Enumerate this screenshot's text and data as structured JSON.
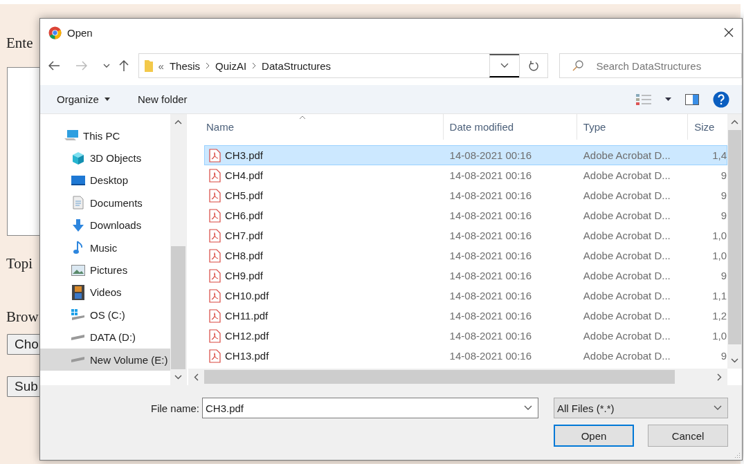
{
  "page": {
    "labels": [
      "Ente",
      "Topi",
      "Brow"
    ],
    "buttons": [
      "Cho",
      "Sub"
    ]
  },
  "dialog": {
    "title": "Open",
    "breadcrumb": {
      "overflow": "«",
      "parts": [
        "Thesis",
        "QuizAI",
        "DataStructures"
      ]
    },
    "search": {
      "placeholder": "Search DataStructures"
    },
    "toolbar": {
      "organize": "Organize",
      "new_folder": "New folder"
    },
    "sidebar": {
      "items": [
        {
          "label": "This PC",
          "kind": "pc",
          "selected": false,
          "children": [
            {
              "label": "3D Objects",
              "kind": "cube",
              "selected": false
            },
            {
              "label": "Desktop",
              "kind": "desktop",
              "selected": false
            },
            {
              "label": "Documents",
              "kind": "documents",
              "selected": false
            },
            {
              "label": "Downloads",
              "kind": "downloads",
              "selected": false
            },
            {
              "label": "Music",
              "kind": "music",
              "selected": false
            },
            {
              "label": "Pictures",
              "kind": "pictures",
              "selected": false
            },
            {
              "label": "Videos",
              "kind": "videos",
              "selected": false
            },
            {
              "label": "OS (C:)",
              "kind": "os-drive",
              "selected": false
            },
            {
              "label": "DATA (D:)",
              "kind": "drive",
              "selected": false
            },
            {
              "label": "New Volume (E:)",
              "kind": "drive",
              "selected": true
            }
          ]
        }
      ]
    },
    "table": {
      "columns": [
        "Name",
        "Date modified",
        "Type",
        "Size"
      ],
      "rows": [
        {
          "name": "CH3.pdf",
          "date": "14-08-2021 00:16",
          "type": "Adobe Acrobat D...",
          "size": "1,4",
          "selected": true
        },
        {
          "name": "CH4.pdf",
          "date": "14-08-2021 00:16",
          "type": "Adobe Acrobat D...",
          "size": "9",
          "selected": false
        },
        {
          "name": "CH5.pdf",
          "date": "14-08-2021 00:16",
          "type": "Adobe Acrobat D...",
          "size": "9",
          "selected": false
        },
        {
          "name": "CH6.pdf",
          "date": "14-08-2021 00:16",
          "type": "Adobe Acrobat D...",
          "size": "9",
          "selected": false
        },
        {
          "name": "CH7.pdf",
          "date": "14-08-2021 00:16",
          "type": "Adobe Acrobat D...",
          "size": "1,0",
          "selected": false
        },
        {
          "name": "CH8.pdf",
          "date": "14-08-2021 00:16",
          "type": "Adobe Acrobat D...",
          "size": "1,0",
          "selected": false
        },
        {
          "name": "CH9.pdf",
          "date": "14-08-2021 00:16",
          "type": "Adobe Acrobat D...",
          "size": "9",
          "selected": false
        },
        {
          "name": "CH10.pdf",
          "date": "14-08-2021 00:16",
          "type": "Adobe Acrobat D...",
          "size": "1,1",
          "selected": false
        },
        {
          "name": "CH11.pdf",
          "date": "14-08-2021 00:16",
          "type": "Adobe Acrobat D...",
          "size": "1,2",
          "selected": false
        },
        {
          "name": "CH12.pdf",
          "date": "14-08-2021 00:16",
          "type": "Adobe Acrobat D...",
          "size": "1,0",
          "selected": false
        },
        {
          "name": "CH13.pdf",
          "date": "14-08-2021 00:16",
          "type": "Adobe Acrobat D...",
          "size": "9",
          "selected": false
        }
      ]
    },
    "file_name": {
      "label": "File name:",
      "value": "CH3.pdf"
    },
    "file_type": {
      "value": "All Files (*.*)"
    },
    "buttons": {
      "open": "Open",
      "cancel": "Cancel"
    }
  }
}
